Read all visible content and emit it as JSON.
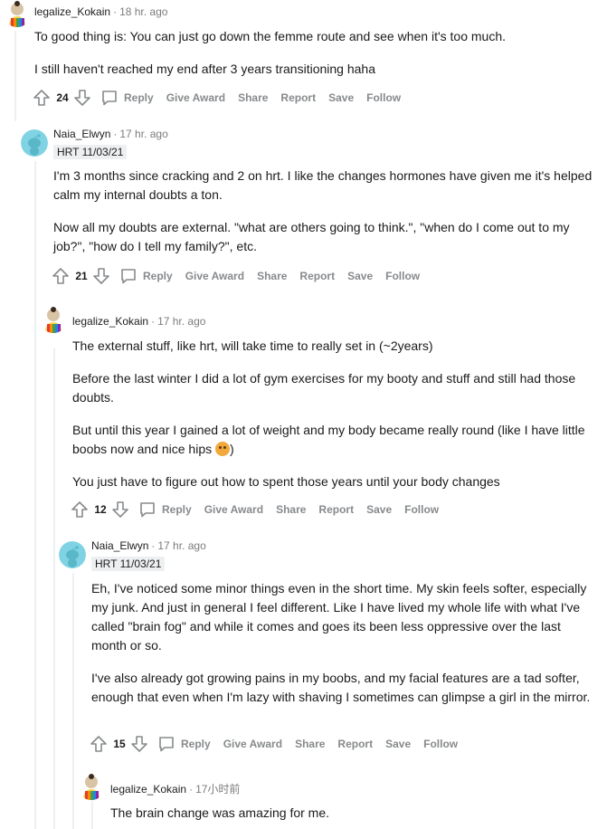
{
  "comments": [
    {
      "author": "legalize_Kokain",
      "time": "18 hr. ago",
      "flair": "",
      "paragraphs": [
        "To good thing is: You can just go down the femme route and see when it's too much.",
        "I still haven't reached my end after 3 years transitioning haha"
      ],
      "score": "24"
    },
    {
      "author": "Naia_Elwyn",
      "time": "17 hr. ago",
      "flair": "HRT 11/03/21",
      "paragraphs": [
        "I'm 3 months since cracking and 2 on hrt. I like the changes hormones have given me it's helped calm my internal doubts a ton.",
        "Now all my doubts are external. \"what are others going to think.\", \"when do I come out to my job?\", \"how do I tell my family?\", etc."
      ],
      "score": "21"
    },
    {
      "author": "legalize_Kokain",
      "time": "17 hr. ago",
      "flair": "",
      "paragraphs": [
        "The external stuff, like hrt, will take time to really set in (~2years)",
        "Before the last winter I did a lot of gym exercises for my booty and stuff and still had those doubts.",
        "But until this year I gained a lot of weight and my body became really round (like I have little boobs now and nice hips",
        "You just have to figure out how to spent those years until your body changes"
      ],
      "paragraph_suffix": ")",
      "score": "12"
    },
    {
      "author": "Naia_Elwyn",
      "time": "17 hr. ago",
      "flair": "HRT 11/03/21",
      "paragraphs": [
        "Eh, I've noticed some minor things even in the short time. My skin feels softer, especially my junk. And just in general I feel different. Like I have lived my whole life with what I've called \"brain fog\" and while it comes and goes its been less oppressive over the last month or so.",
        "I've also already got growing pains in my boobs, and my facial features are a tad softer, enough that even when I'm lazy with shaving I sometimes can glimpse a girl in the mirror."
      ],
      "score": "15"
    },
    {
      "author": "legalize_Kokain",
      "time": "17小时前",
      "flair": "",
      "paragraphs": [
        "The brain change was amazing for me."
      ],
      "score": ""
    }
  ],
  "actions": {
    "reply": "Reply",
    "give_award": "Give Award",
    "share": "Share",
    "report": "Report",
    "save": "Save",
    "follow": "Follow"
  },
  "colors": {
    "meta_text": "#7c7c7c",
    "action_text": "#878a8c",
    "thread_line": "#edeff1",
    "flair_bg": "#edeff1",
    "snoo_bg": "#7fd3e3"
  },
  "icons": [
    "upvote-icon",
    "downvote-icon",
    "comment-icon",
    "smiley-emoji",
    "snoo-avatar",
    "rainbow-avatar"
  ]
}
